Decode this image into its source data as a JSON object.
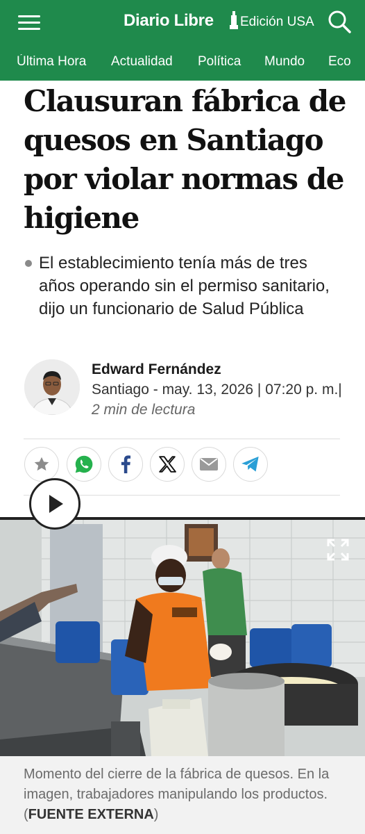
{
  "header": {
    "logo": "Diario Libre",
    "edition": "Edición USA",
    "brand_color": "#1f8a4c",
    "nav": [
      "Última Hora",
      "Actualidad",
      "Política",
      "Mundo",
      "Eco"
    ]
  },
  "article": {
    "headline": "Clausuran fábrica de quesos en Santiago por violar normas de higiene",
    "summary": "El establecimiento tenía más de tres años operando sin el permiso sanitario, dijo un funcionario de Salud Pública",
    "author": "Edward Fernández",
    "dateline": "Santiago - may. 13, 2026 | 07:20 p. m.|",
    "read_time": "2 min de lectura"
  },
  "share": [
    "star-icon",
    "whatsapp-icon",
    "facebook-icon",
    "x-icon",
    "email-icon",
    "telegram-icon"
  ],
  "media": {
    "caption_text": "Momento del cierre de la fábrica de quesos. En la imagen, trabajadores manipulando los productos. (",
    "caption_source": "FUENTE EXTERNA",
    "caption_end": ")"
  }
}
